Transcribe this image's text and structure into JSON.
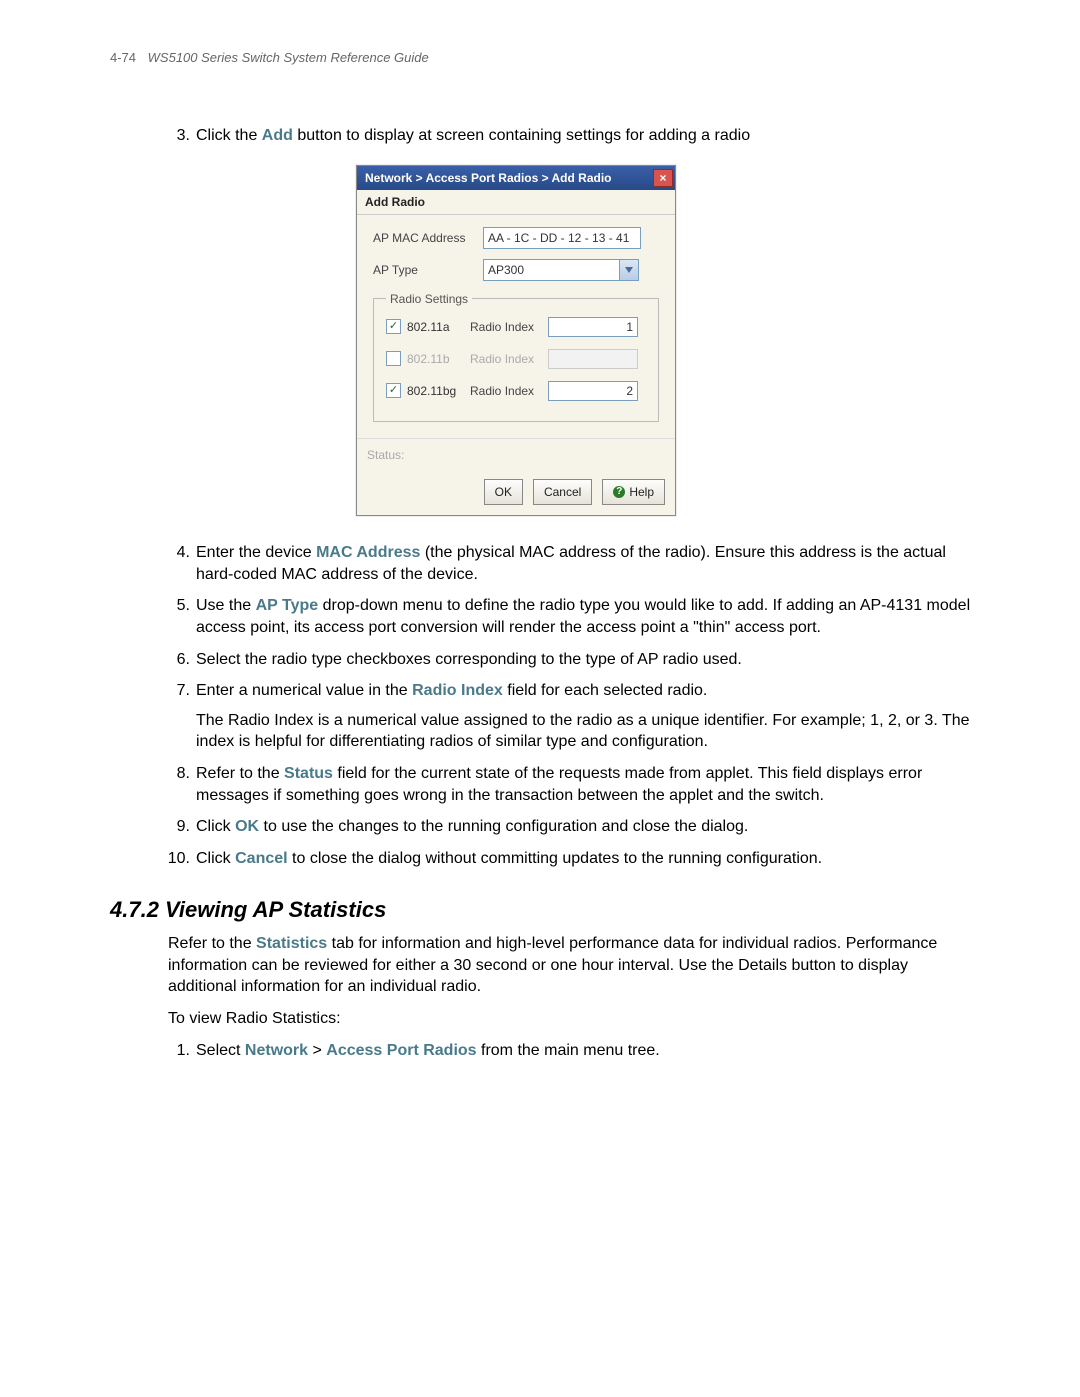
{
  "header": {
    "page_number": "4-74",
    "doc_title": "WS5100 Series Switch System Reference Guide"
  },
  "steps": {
    "s3_a": "Click the ",
    "s3_kw": "Add",
    "s3_b": " button to display at screen containing settings for adding a radio",
    "s4_a": "Enter the device ",
    "s4_kw": "MAC Address",
    "s4_b": " (the physical MAC address of the radio). Ensure this address is the actual hard-coded MAC address of the device.",
    "s5_a": "Use the ",
    "s5_kw": "AP Type",
    "s5_b": " drop-down menu to define the radio type you would like to add. If adding an AP-4131 model access point, its access port conversion will render the access point a \"thin\" access port.",
    "s6": "Select the radio type checkboxes corresponding to the type of AP radio used.",
    "s7_a": "Enter a numerical value in the ",
    "s7_kw": "Radio Index",
    "s7_b": " field for each selected radio.",
    "s7_para": "The Radio Index is a numerical value assigned to the radio as a unique identifier. For example; 1, 2, or 3. The index is helpful for differentiating radios of similar type and configuration.",
    "s8_a": "Refer to the ",
    "s8_kw": "Status",
    "s8_b": " field for the current state of the requests made from applet. This field displays error messages if something goes wrong in the transaction between the applet and the switch.",
    "s9_a": "Click ",
    "s9_kw": "OK",
    "s9_b": " to use the changes to the running configuration and close the dialog.",
    "s10_a": "Click ",
    "s10_kw": "Cancel",
    "s10_b": " to close the dialog without committing updates to the running configuration."
  },
  "section": {
    "title": "4.7.2  Viewing AP Statistics",
    "p1_a": "Refer to the ",
    "p1_kw": "Statistics",
    "p1_b": " tab for information and high-level performance data for individual radios. Performance information can be reviewed for either a 30 second or one hour interval. Use the Details button to display additional information for an individual radio.",
    "p2": "To view Radio Statistics:",
    "step1_a": "Select ",
    "step1_kw1": "Network",
    "step1_mid": " > ",
    "step1_kw2": "Access Port Radios",
    "step1_b": " from the main menu tree."
  },
  "dialog": {
    "breadcrumb": "Network > Access Port Radios > Add Radio",
    "subtitle": "Add Radio",
    "mac_label": "AP MAC Address",
    "mac_value": "AA - 1C - DD - 12 - 13 - 41",
    "aptype_label": "AP Type",
    "aptype_value": "AP300",
    "fieldset_title": "Radio Settings",
    "rows": [
      {
        "name": "802.11a",
        "checked": true,
        "index_label": "Radio Index",
        "index_value": "1"
      },
      {
        "name": "802.11b",
        "checked": false,
        "index_label": "Radio Index",
        "index_value": ""
      },
      {
        "name": "802.11bg",
        "checked": true,
        "index_label": "Radio Index",
        "index_value": "2"
      }
    ],
    "status_label": "Status:",
    "buttons": {
      "ok": "OK",
      "cancel": "Cancel",
      "help": "Help"
    }
  }
}
